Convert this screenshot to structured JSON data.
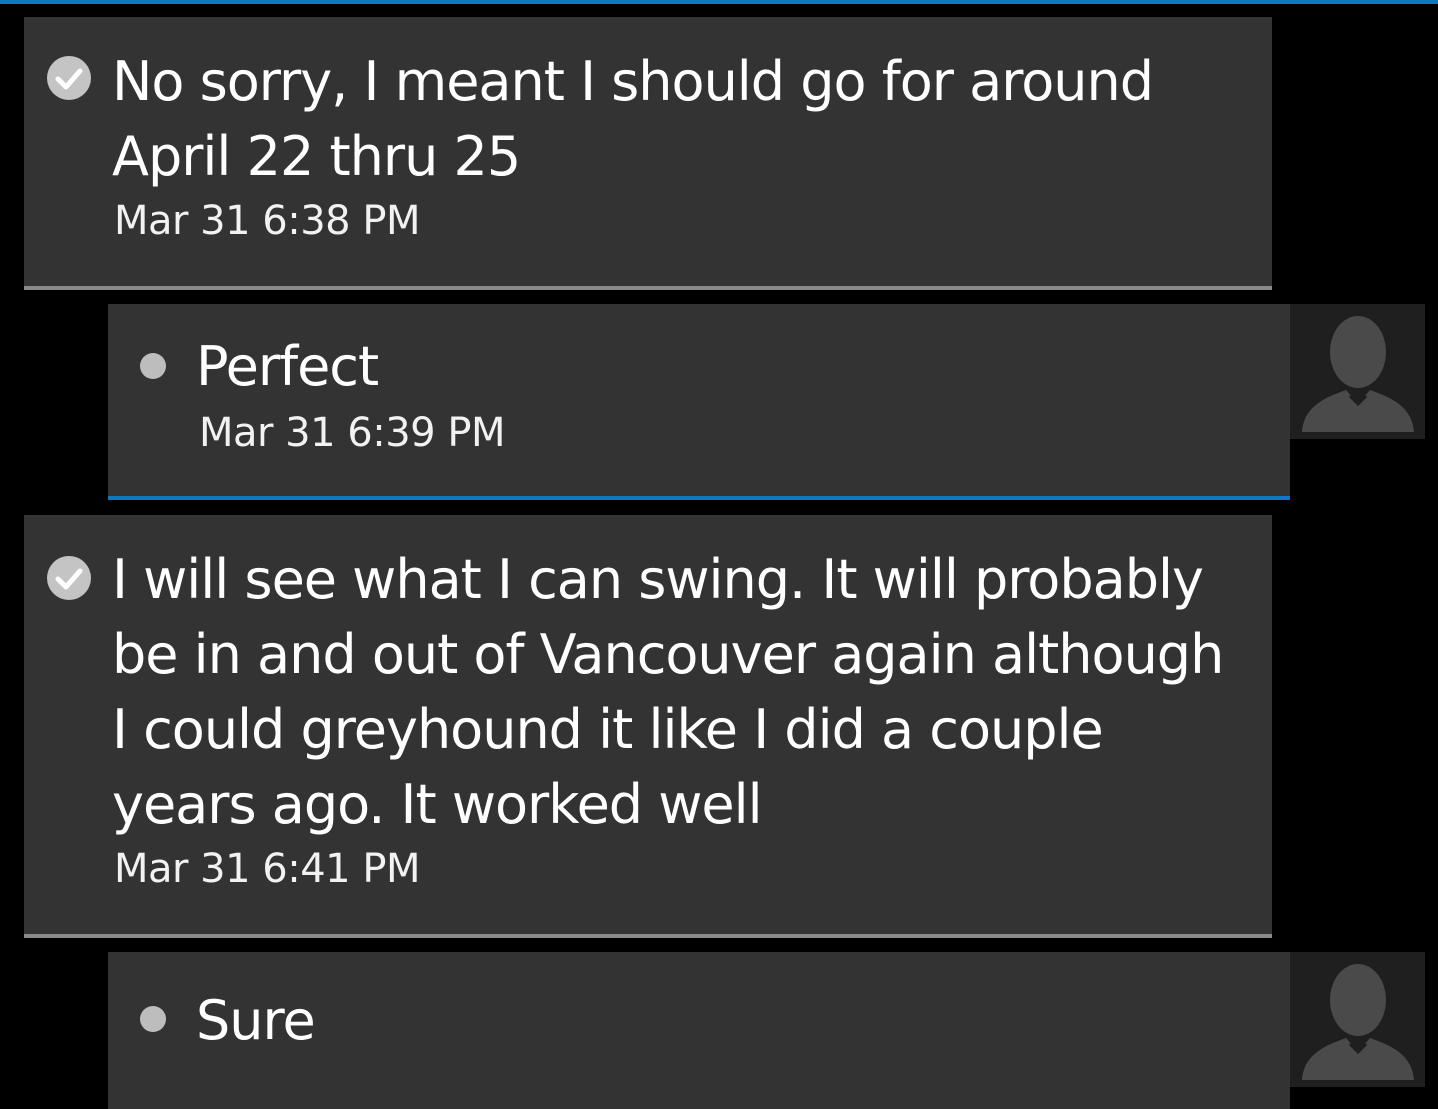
{
  "messages": [
    {
      "direction": "sent",
      "text": "No sorry, I meant I should go for around April 22 thru 25",
      "time": "Mar 31 6:38 PM",
      "status_icon": "delivered-check-icon"
    },
    {
      "direction": "received",
      "text": "Perfect",
      "time": "Mar 31 6:39 PM",
      "status_icon": "dot-icon",
      "avatar_icon": "default-person-avatar-icon"
    },
    {
      "direction": "sent",
      "text": "I will see what I can swing. It will probably be in and out of Vancouver again although I could greyhound it like I did a couple years ago. It worked well",
      "time": "Mar 31 6:41 PM",
      "status_icon": "delivered-check-icon"
    },
    {
      "direction": "received",
      "text": "Sure",
      "status_icon": "dot-icon",
      "avatar_icon": "default-person-avatar-icon"
    }
  ],
  "colors": {
    "background": "#000000",
    "bubble": "#333333",
    "accent": "#0f78c2",
    "sent_divider": "#8a8a8a",
    "text": "#ffffff"
  }
}
